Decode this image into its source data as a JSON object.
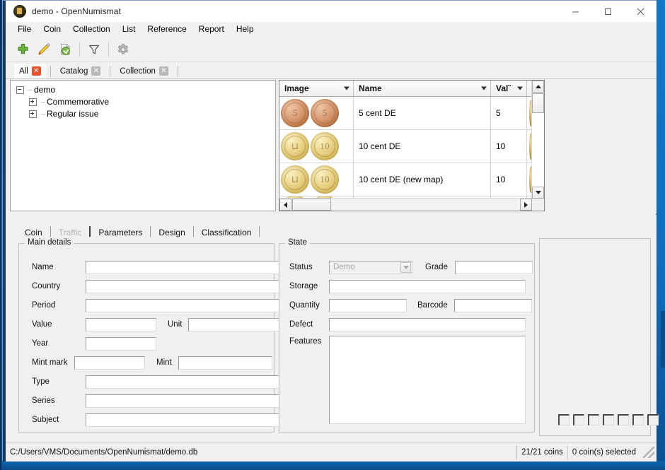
{
  "window": {
    "title": "demo - OpenNumismat",
    "app_icon": "coin-icon",
    "minimize_label": "–",
    "maximize_label": "☐",
    "close_label": "✕"
  },
  "menubar": {
    "items": [
      {
        "label": "File"
      },
      {
        "label": "Coin"
      },
      {
        "label": "Collection"
      },
      {
        "label": "List"
      },
      {
        "label": "Reference"
      },
      {
        "label": "Report"
      },
      {
        "label": "Help"
      }
    ]
  },
  "toolbar": {
    "buttons": [
      {
        "name": "add-coin-button",
        "icon": "plus-icon"
      },
      {
        "name": "edit-coin-button",
        "icon": "pencil-icon"
      },
      {
        "name": "copy-coin-button",
        "icon": "copy-page-icon"
      },
      {
        "name": "filter-button",
        "icon": "funnel-icon"
      },
      {
        "name": "settings-button",
        "icon": "gear-icon"
      }
    ]
  },
  "list_tabs": [
    {
      "label": "All",
      "active": true,
      "close": "✕"
    },
    {
      "label": "Catalog",
      "active": false,
      "close": "✕"
    },
    {
      "label": "Collection",
      "active": false,
      "close": "✕"
    }
  ],
  "tree": {
    "root": {
      "label": "demo",
      "expander": "minus"
    },
    "children": [
      {
        "label": "Commemorative",
        "expander": "plus"
      },
      {
        "label": "Regular issue",
        "expander": "plus"
      }
    ]
  },
  "table": {
    "columns": [
      {
        "key": "image",
        "label": "Image"
      },
      {
        "key": "name",
        "label": "Name"
      },
      {
        "key": "value",
        "label": "Val˘"
      }
    ],
    "rows": [
      {
        "name": "5 cent DE",
        "value": "5",
        "obverse": "copper",
        "reverse": "copper"
      },
      {
        "name": "10 cent DE",
        "value": "10",
        "obverse": "gold",
        "reverse": "gold"
      },
      {
        "name": "10 cent DE (new map)",
        "value": "10",
        "obverse": "gold",
        "reverse": "gold"
      }
    ]
  },
  "detail_tabs": [
    {
      "label": "Coin",
      "state": "active"
    },
    {
      "label": "Traffic",
      "state": "disabled"
    },
    {
      "label": "Parameters",
      "state": "normal"
    },
    {
      "label": "Design",
      "state": "normal"
    },
    {
      "label": "Classification",
      "state": "normal"
    }
  ],
  "main_details": {
    "legend": "Main details",
    "fields": [
      {
        "label": "Name",
        "value": "",
        "name": "name-field"
      },
      {
        "label": "Country",
        "value": "",
        "name": "country-field"
      },
      {
        "label": "Period",
        "value": "",
        "name": "period-field"
      },
      {
        "label": "Value",
        "value": "",
        "name": "value-field"
      },
      {
        "label": "Unit",
        "value": "",
        "name": "unit-field"
      },
      {
        "label": "Year",
        "value": "",
        "name": "year-field"
      },
      {
        "label": "Mint mark",
        "value": "",
        "name": "mint-mark-field"
      },
      {
        "label": "Mint",
        "value": "",
        "name": "mint-field"
      },
      {
        "label": "Type",
        "value": "",
        "name": "type-field"
      },
      {
        "label": "Series",
        "value": "",
        "name": "series-field"
      },
      {
        "label": "Subject",
        "value": "",
        "name": "subject-field"
      }
    ]
  },
  "state_panel": {
    "legend": "State",
    "status_label": "Status",
    "status_value": "Demo",
    "grade_label": "Grade",
    "grade_value": "",
    "storage_label": "Storage",
    "storage_value": "",
    "quantity_label": "Quantity",
    "quantity_value": "",
    "barcode_label": "Barcode",
    "barcode_value": "",
    "defect_label": "Defect",
    "defect_value": "",
    "features_label": "Features",
    "features_value": ""
  },
  "image_slots": {
    "count": 7
  },
  "statusbar": {
    "path": "C:/Users/VMS/Documents/OpenNumismat/demo.db",
    "coins": "21/21 coins",
    "selected": "0 coin(s) selected"
  },
  "colors": {
    "accent_close": "#e8502e",
    "desktop_blue": "#1277c8",
    "panel_bg": "#f0f0f0",
    "toolbar_plus": "#4f9a2f",
    "toolbar_pencil": "#e8b007"
  }
}
